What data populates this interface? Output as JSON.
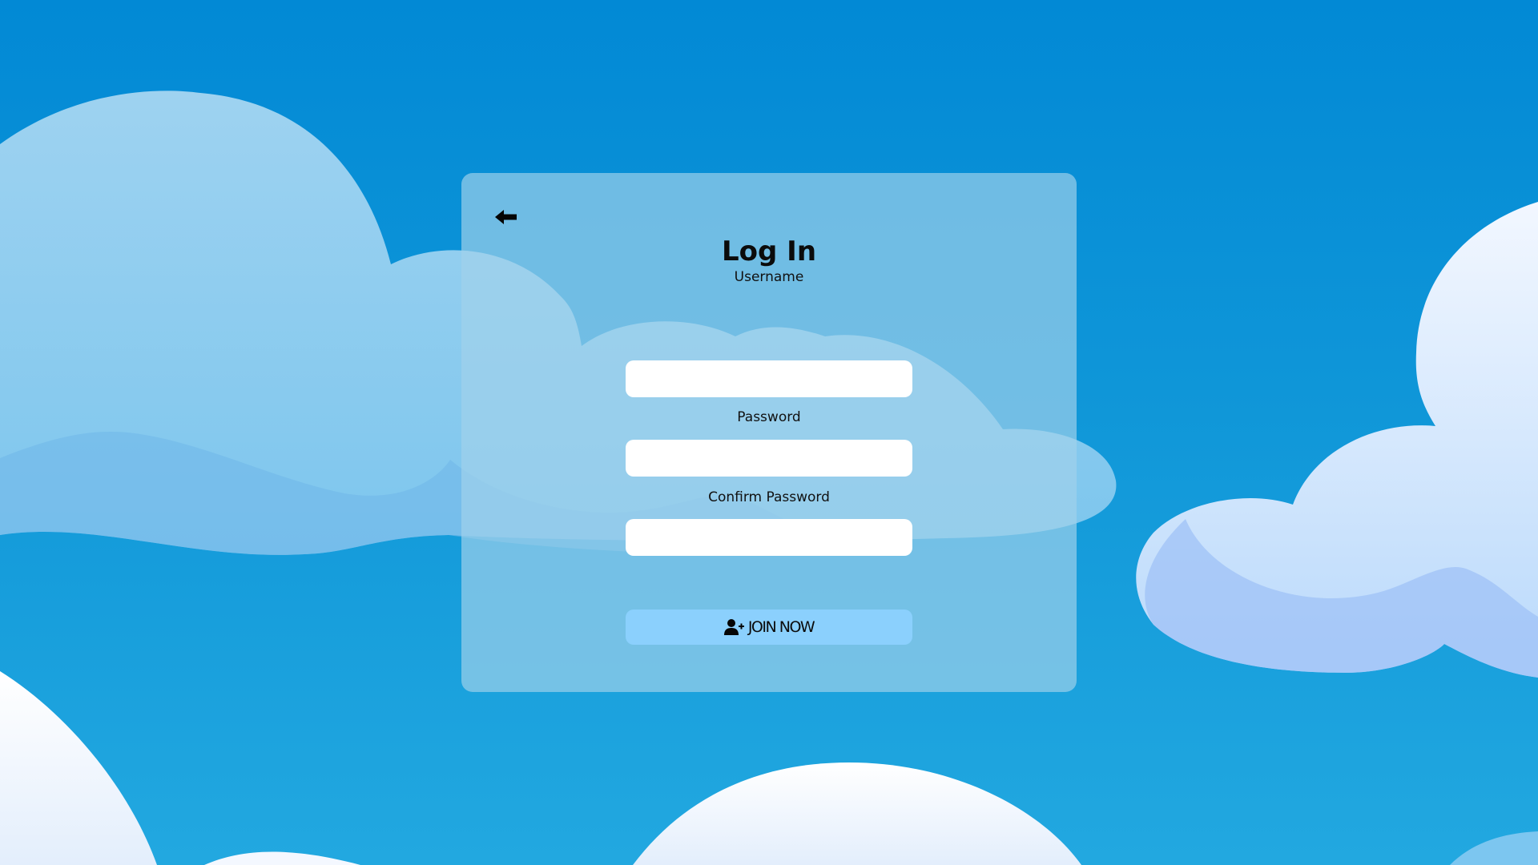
{
  "form": {
    "title": "Log In",
    "back_icon": "arrow-left-icon",
    "fields": [
      {
        "label": "Username",
        "value": "",
        "placeholder": ""
      },
      {
        "label": "Password",
        "value": "",
        "placeholder": ""
      },
      {
        "label": "Confirm Password",
        "value": "",
        "placeholder": ""
      }
    ],
    "submit": {
      "label": "JOIN NOW",
      "icon": "user-plus-icon"
    }
  },
  "colors": {
    "sky_top": "#0289d5",
    "sky_bottom": "#22a8e0",
    "card": "#a0d2eb",
    "button": "#8bd0fd",
    "input": "#ffffff"
  }
}
